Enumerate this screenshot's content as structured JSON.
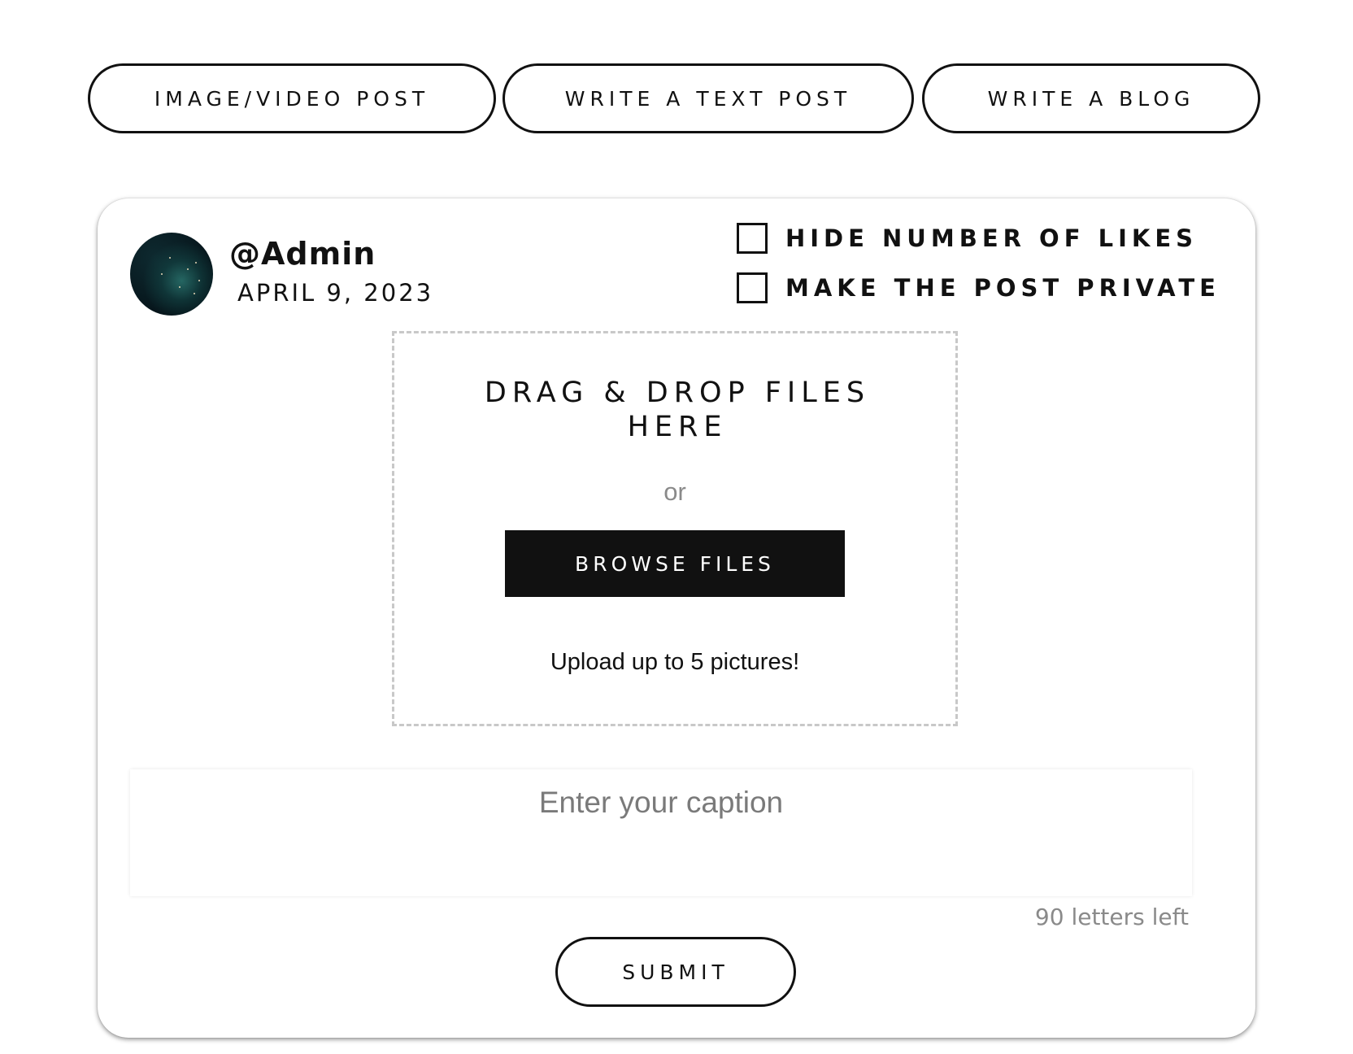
{
  "tabs": [
    {
      "label": "IMAGE/VIDEO POST"
    },
    {
      "label": "WRITE A TEXT POST"
    },
    {
      "label": "WRITE A BLOG"
    }
  ],
  "post": {
    "username": "@Admin",
    "date": "APRIL 9, 2023",
    "options": [
      {
        "label": "HIDE NUMBER OF LIKES",
        "checked": false
      },
      {
        "label": "MAKE THE POST PRIVATE",
        "checked": false
      }
    ]
  },
  "upload": {
    "title": "DRAG & DROP FILES HERE",
    "or_text": "or",
    "browse_label": "BROWSE FILES",
    "note": "Upload up to 5 pictures!"
  },
  "caption": {
    "placeholder": "Enter your caption",
    "value": "",
    "counter": "90 letters left"
  },
  "submit": {
    "label": "SUBMIT"
  },
  "icons": {
    "avatar": "galaxy-avatar-image",
    "checkbox": "empty-checkbox"
  },
  "colors": {
    "text": "#111111",
    "primary_button_bg": "#111111",
    "primary_button_text": "#ffffff",
    "muted_text": "#8a8a8a",
    "dropzone_border": "#c8c8c8",
    "background": "#ffffff"
  }
}
